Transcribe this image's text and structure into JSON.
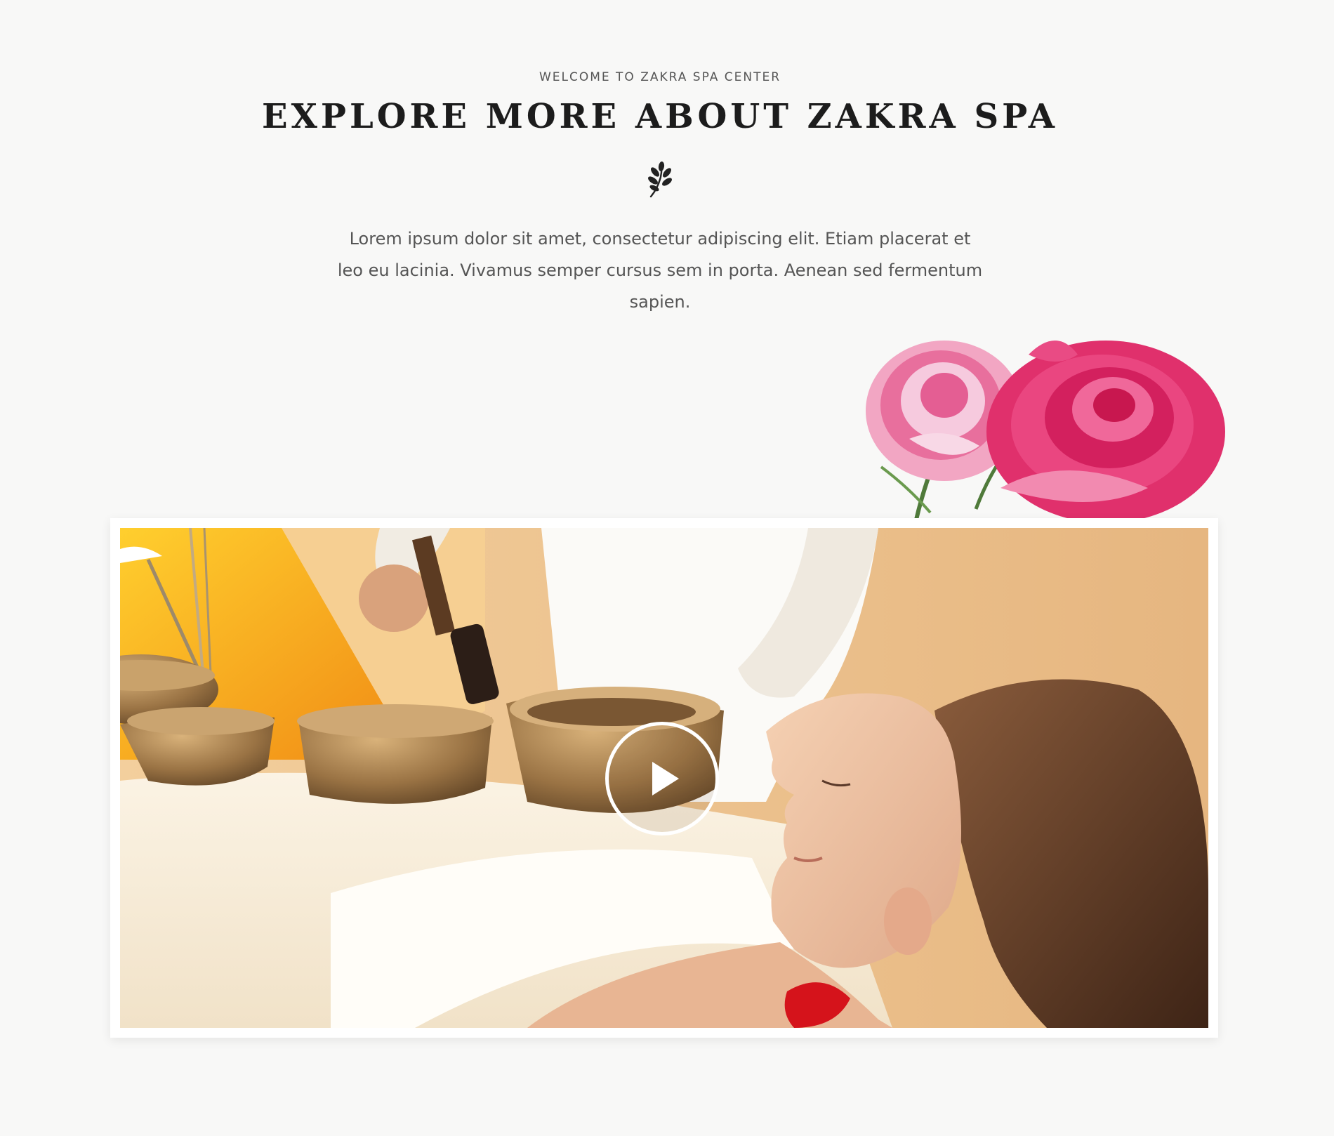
{
  "about_section": {
    "eyebrow": "WELCOME TO ZAKRA SPA CENTER",
    "title": "EXPLORE MORE ABOUT ZAKRA SPA",
    "divider_icon": "leaf-icon",
    "description": "Lorem ipsum dolor sit amet, consectetur adipiscing elit. Etiam placerat et leo eu lacinia. Vivamus semper cursus sem in porta. Aenean sed fermentum sapien."
  },
  "decoration": {
    "image": "rose-illustration"
  },
  "video": {
    "thumbnail": "singing-bowl-massage-photo",
    "play_icon": "play-icon"
  },
  "colors": {
    "background": "#f8f8f7",
    "title": "#1c1c1c",
    "body_text": "#555555",
    "rose": "#e2316f"
  }
}
